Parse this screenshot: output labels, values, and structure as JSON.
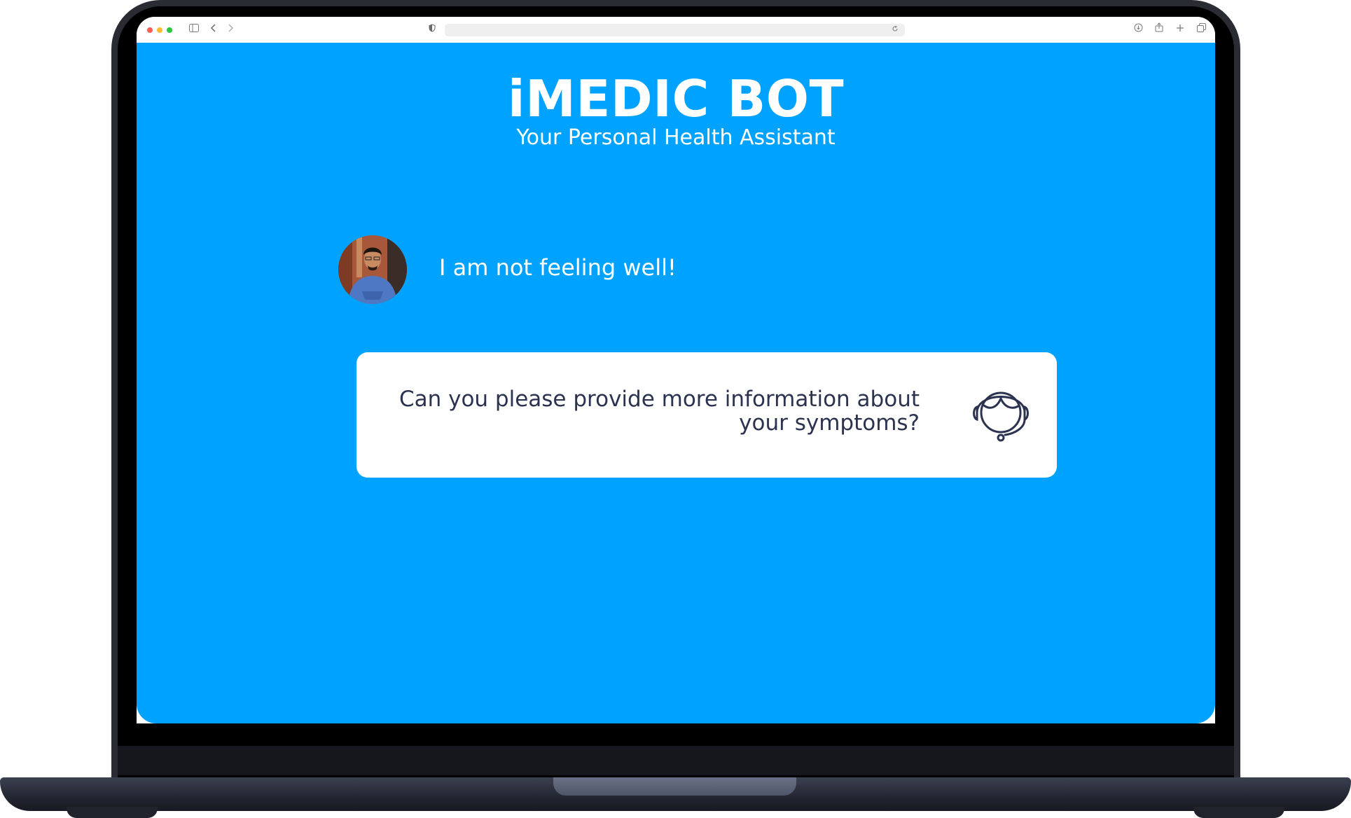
{
  "app": {
    "title": "iMEDIC BOT",
    "subtitle": "Your Personal Health Assistant"
  },
  "browser": {
    "toolbar_icons": [
      "sidebar-icon",
      "back-icon",
      "forward-icon",
      "shield-icon",
      "reload-icon",
      "download-icon",
      "share-icon",
      "new-tab-icon",
      "tabs-overview-icon"
    ]
  },
  "chat": {
    "user_message": "I am not feeling well!",
    "bot_message": "Can you please provide more information about your symptoms?"
  },
  "colors": {
    "background": "#00a2ff",
    "card": "#ffffff",
    "bot_text": "#2c3350"
  }
}
